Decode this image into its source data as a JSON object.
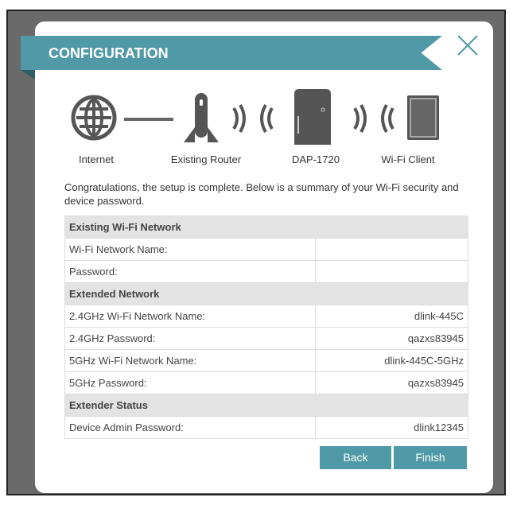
{
  "title": "CONFIGURATION",
  "diagram": {
    "labels": [
      "Internet",
      "Existing Router",
      "DAP-1720",
      "Wi-Fi Client"
    ]
  },
  "intro": "Congratulations, the setup is complete. Below is a summary of your Wi-Fi security and device password.",
  "sections": [
    {
      "title": "Existing Wi-Fi Network",
      "rows": [
        {
          "label": "Wi-Fi Network Name:",
          "value": ""
        },
        {
          "label": "Password:",
          "value": ""
        }
      ]
    },
    {
      "title": "Extended Network",
      "rows": [
        {
          "label": "2.4GHz Wi-Fi Network Name:",
          "value": "dlink-445C"
        },
        {
          "label": "2.4GHz Password:",
          "value": "qazxs83945"
        },
        {
          "label": "5GHz Wi-Fi Network Name:",
          "value": "dlink-445C-5GHz"
        },
        {
          "label": "5GHz Password:",
          "value": "qazxs83945"
        }
      ]
    },
    {
      "title": "Extender Status",
      "rows": [
        {
          "label": "Device Admin Password:",
          "value": "dlink12345"
        }
      ]
    }
  ],
  "buttons": {
    "back": "Back",
    "finish": "Finish"
  },
  "colors": {
    "accent": "#4f9aa6"
  }
}
